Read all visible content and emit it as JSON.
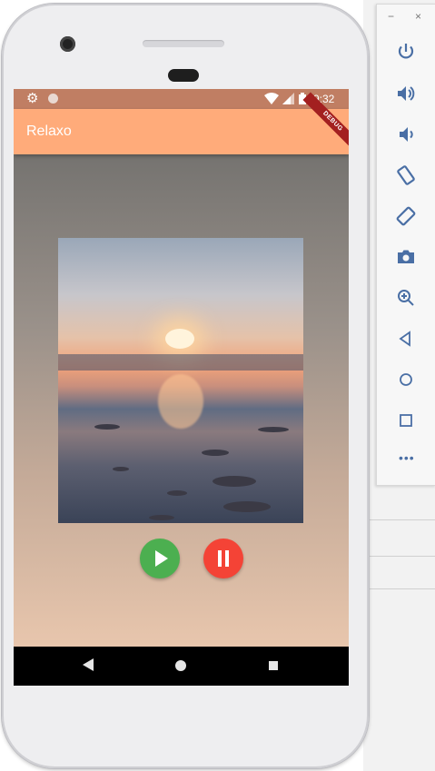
{
  "status_bar": {
    "time": "9:32",
    "icons": [
      "gear-icon",
      "circle-icon",
      "wifi-icon",
      "signal-icon",
      "battery-icon"
    ]
  },
  "app_bar": {
    "title": "Relaxo",
    "debug_banner": "DEBUG",
    "color": "#ffab7a"
  },
  "player": {
    "artwork": "sunset-beach-image",
    "play_color": "#4caf50",
    "pause_color": "#f44336"
  },
  "nav_bar": {
    "buttons": [
      "back-icon",
      "home-icon",
      "recents-icon"
    ]
  },
  "emulator_toolbar": {
    "window_controls": [
      "−",
      "×"
    ],
    "buttons": [
      "power-icon",
      "volume-up-icon",
      "volume-down-icon",
      "rotate-left-icon",
      "rotate-right-icon",
      "camera-icon",
      "zoom-icon",
      "back-icon",
      "home-icon",
      "overview-icon"
    ],
    "more_label": "•••",
    "accent": "#4a6fa5"
  }
}
